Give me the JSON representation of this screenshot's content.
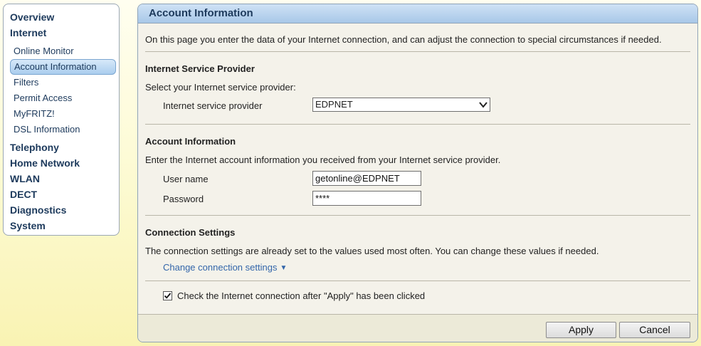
{
  "sidebar": {
    "items": [
      {
        "label": "Overview"
      },
      {
        "label": "Internet"
      },
      {
        "label": "Online Monitor"
      },
      {
        "label": "Account Information",
        "active": true
      },
      {
        "label": "Filters"
      },
      {
        "label": "Permit Access"
      },
      {
        "label": "MyFRITZ!"
      },
      {
        "label": "DSL Information"
      },
      {
        "label": "Telephony"
      },
      {
        "label": "Home Network"
      },
      {
        "label": "WLAN"
      },
      {
        "label": "DECT"
      },
      {
        "label": "Diagnostics"
      },
      {
        "label": "System"
      }
    ]
  },
  "panel": {
    "title": "Account Information",
    "intro": "On this page you enter the data of your Internet connection, and can adjust the connection to special circumstances if needed.",
    "isp": {
      "title": "Internet Service Provider",
      "description": "Select your Internet service provider:",
      "field_label": "Internet service provider",
      "selected": "EDPNET"
    },
    "account": {
      "title": "Account Information",
      "description": "Enter the Internet account information you received from your Internet service provider.",
      "username_label": "User name",
      "username_value": "getonline@EDPNET",
      "password_label": "Password",
      "password_value": "****"
    },
    "connection": {
      "title": "Connection Settings",
      "description": "The connection settings are already set to the values used most often. You can change these values if needed.",
      "link_label": "Change connection settings",
      "link_icon": "triangle-down-icon"
    },
    "check": {
      "label": "Check the Internet connection after \"Apply\" has been clicked",
      "checked": true
    },
    "buttons": {
      "apply": "Apply",
      "cancel": "Cancel"
    }
  },
  "colors": {
    "header_blue": "#a8c8e8",
    "nav_text": "#1d3a5c",
    "link": "#3366aa",
    "panel_bg": "#f4f2ea"
  }
}
